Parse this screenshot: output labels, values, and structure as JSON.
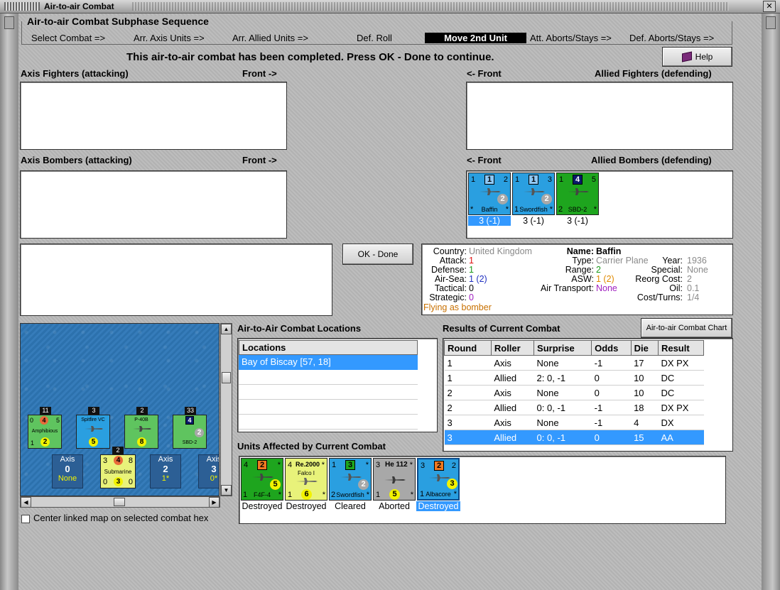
{
  "window": {
    "title": "Air-to-air Combat"
  },
  "sequence": {
    "title": "Air-to-air Combat Subphase Sequence",
    "steps": [
      "Select Combat =>",
      "Arr. Axis Units =>",
      "Arr. Allied Units =>",
      "Def. Roll",
      "Move 2nd Unit",
      "Att. Aborts/Stays =>",
      "Def. Aborts/Stays =>"
    ],
    "active_step": "Move 2nd Unit"
  },
  "status_message": "This air-to-air combat has been completed.  Press OK - Done to continue.",
  "help_label": "Help",
  "panels": {
    "axis_fighters": "Axis Fighters (attacking)",
    "axis_fighters_front": "Front ->",
    "allied_fighters_front": "<- Front",
    "allied_fighters": "Allied Fighters (defending)",
    "axis_bombers": "Axis Bombers (attacking)",
    "axis_bombers_front": "Front ->",
    "allied_bombers_front": "<- Front",
    "allied_bombers": "Allied Bombers (defending)"
  },
  "allied_bombers_units": [
    {
      "name": "Baffin",
      "top_left": "1",
      "top_mid": "1",
      "top_right": "2",
      "circle": "2",
      "bottom_left": "*",
      "bottom_right": "*",
      "odds": "3 (-1)",
      "selected": true,
      "color": "#2a9fe0"
    },
    {
      "name": "Swordfish",
      "top_left": "1",
      "top_mid": "1",
      "top_right": "3",
      "circle": "2",
      "bottom_left": "1",
      "bottom_right": "*",
      "odds": "3 (-1)",
      "selected": false,
      "color": "#2a9fe0"
    },
    {
      "name": "SBD-2",
      "top_left": "1",
      "top_mid": "4",
      "top_right": "5",
      "circle": "",
      "bottom_left": "2",
      "bottom_right": "*",
      "odds": "3 (-1)",
      "selected": false,
      "color": "#1ea51e"
    }
  ],
  "ok_done_label": "OK - Done",
  "unit_info": {
    "country_label": "Country:",
    "country": "United Kingdom",
    "attack_label": "Attack:",
    "attack": "1",
    "defense_label": "Defense:",
    "defense": "1",
    "airsea_label": "Air-Sea:",
    "airsea": "1 (2)",
    "tactical_label": "Tactical:",
    "tactical": "0",
    "strategic_label": "Strategic:",
    "strategic": "0",
    "flying_as": "Flying as bomber",
    "name_label": "Name:",
    "name": "Baffin",
    "type_label": "Type:",
    "type": "Carrier Plane",
    "range_label": "Range:",
    "range": "2",
    "asw_label": "ASW:",
    "asw": "1 (2)",
    "air_transport_label": "Air Transport:",
    "air_transport": "None",
    "year_label": "Year:",
    "year": "1936",
    "special_label": "Special:",
    "special": "None",
    "reorg_label": "Reorg Cost:",
    "reorg": "2",
    "oil_label": "Oil:",
    "oil": "0.1",
    "cost_label": "Cost/Turns:",
    "cost": "1/4"
  },
  "locations": {
    "title": "Air-to-Air Combat Locations",
    "header": "Locations",
    "rows": [
      "Bay of Biscay [57, 18]"
    ]
  },
  "results": {
    "title": "Results of Current Combat",
    "chart_button": "Air-to-air Combat Chart",
    "headers": [
      "Round",
      "Roller",
      "Surprise",
      "Odds",
      "Die",
      "Result"
    ],
    "rows": [
      [
        "1",
        "Axis",
        "None",
        "-1",
        "17",
        "DX PX"
      ],
      [
        "1",
        "Allied",
        "2: 0, -1",
        "0",
        "10",
        "DC"
      ],
      [
        "2",
        "Axis",
        "None",
        "0",
        "10",
        "DC"
      ],
      [
        "2",
        "Allied",
        "0: 0, -1",
        "-1",
        "18",
        "DX PX"
      ],
      [
        "3",
        "Axis",
        "None",
        "-1",
        "4",
        "DX"
      ],
      [
        "3",
        "Allied",
        "0: 0, -1",
        "0",
        "15",
        "AA"
      ]
    ],
    "selected_row": 5
  },
  "affected": {
    "title": "Units Affected by Current Combat",
    "units": [
      {
        "name": "F4F-4",
        "tl": "4",
        "tm": "2",
        "tr": "*",
        "circle": "5",
        "bl": "1",
        "br": "*",
        "status": "Destroyed",
        "color": "#1ea51e",
        "circle_color": "#e8f27a"
      },
      {
        "name": "Falco I",
        "tl": "4",
        "tm": "Re.2000",
        "tr": "*",
        "circle": "6",
        "bl": "1",
        "br": "*",
        "status": "Destroyed",
        "color": "#e8f27a",
        "circle_color": "#f2f200"
      },
      {
        "name": "Swordfish",
        "tl": "1",
        "tm": "3",
        "tr": "*",
        "circle": "2",
        "bl": "2",
        "br": "*",
        "status": "Cleared",
        "color": "#2a9fe0",
        "circle_color": "#a8a8a8"
      },
      {
        "name": "",
        "tl": "3",
        "tm": "He 112",
        "tr": "*",
        "circle": "5",
        "bl": "1",
        "br": "*",
        "status": "Aborted",
        "color": "#a8a8a8",
        "circle_color": "#f2f200"
      },
      {
        "name": "Albacore",
        "tl": "3",
        "tm": "2",
        "tr": "2",
        "circle": "3",
        "bl": "1",
        "br": "*",
        "status": "Destroyed",
        "color": "#2a9fe0",
        "circle_color": "#f2f200",
        "selected": true
      }
    ]
  },
  "map": {
    "counters": [
      {
        "name": "Amphibious",
        "tag": "11",
        "tl": "0",
        "tm": "4",
        "tr": "5",
        "circle": "2",
        "bl": "1",
        "color": "#5fc45f"
      },
      {
        "name": "Spitfire VC",
        "tag": "3",
        "tl": "",
        "tm": "",
        "tr": "",
        "circle": "5",
        "bl": "",
        "color": "#2a9fe0"
      },
      {
        "name": "P-40B",
        "tag": "2",
        "tl": "",
        "tm": "",
        "tr": "",
        "circle": "8",
        "bl": "",
        "color": "#5fc45f"
      },
      {
        "name": "SBD-2",
        "tag": "33",
        "tl": "",
        "tm": "4",
        "tr": "",
        "circle": "2",
        "bl": "",
        "color": "#5fc45f"
      }
    ],
    "submarine": {
      "name": "Submarine",
      "tag": "2",
      "tl": "3",
      "tm": "4",
      "tr": "8",
      "bl": "0",
      "circle": "3",
      "br": "0"
    },
    "axis_boxes": [
      {
        "label": "Axis",
        "value": "0",
        "sub": "None"
      },
      {
        "label": "Axis",
        "value": "2",
        "sub": "1*"
      },
      {
        "label": "Axis",
        "value": "3",
        "sub": "0*"
      }
    ]
  },
  "center_map_label": "Center linked map on selected combat hex"
}
